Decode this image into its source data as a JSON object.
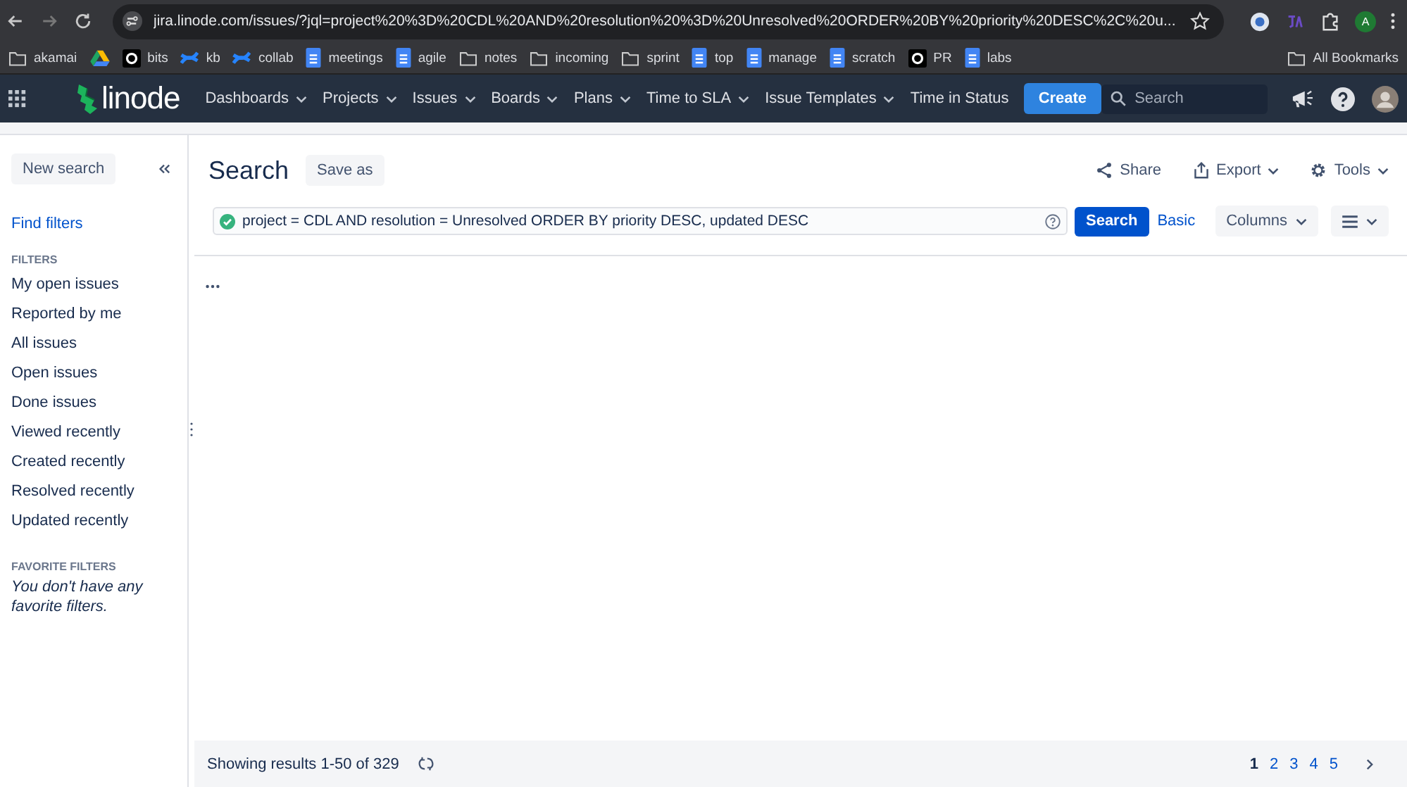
{
  "browser": {
    "url": "jira.linode.com/issues/?jql=project%20%3D%20CDL%20AND%20resolution%20%3D%20Unresolved%20ORDER%20BY%20priority%20DESC%2C%20u...",
    "profile": "A",
    "bookmarks": [
      {
        "label": "akamai",
        "kind": "folder"
      },
      {
        "kind": "drive"
      },
      {
        "label": "bits",
        "kind": "github"
      },
      {
        "label": "kb",
        "kind": "confluence"
      },
      {
        "label": "collab",
        "kind": "confluence"
      },
      {
        "label": "meetings",
        "kind": "doc"
      },
      {
        "label": "agile",
        "kind": "doc"
      },
      {
        "label": "notes",
        "kind": "folder"
      },
      {
        "label": "incoming",
        "kind": "folder"
      },
      {
        "label": "sprint",
        "kind": "folder"
      },
      {
        "label": "top",
        "kind": "doc"
      },
      {
        "label": "manage",
        "kind": "doc"
      },
      {
        "label": "scratch",
        "kind": "doc"
      },
      {
        "label": "PR",
        "kind": "github"
      },
      {
        "label": "labs",
        "kind": "doc"
      }
    ],
    "all_bookmarks": "All Bookmarks"
  },
  "nav": {
    "logo": "linode",
    "items": [
      {
        "label": "Dashboards",
        "dropdown": true
      },
      {
        "label": "Projects",
        "dropdown": true
      },
      {
        "label": "Issues",
        "dropdown": true
      },
      {
        "label": "Boards",
        "dropdown": true
      },
      {
        "label": "Plans",
        "dropdown": true
      },
      {
        "label": "Time to SLA",
        "dropdown": true
      },
      {
        "label": "Issue Templates",
        "dropdown": true
      },
      {
        "label": "Time in Status",
        "dropdown": false
      }
    ],
    "create": "Create",
    "search_placeholder": "Search"
  },
  "sidebar": {
    "new_search": "New search",
    "find_filters": "Find filters",
    "filters_heading": "FILTERS",
    "filters": [
      "My open issues",
      "Reported by me",
      "All issues",
      "Open issues",
      "Done issues",
      "Viewed recently",
      "Created recently",
      "Resolved recently",
      "Updated recently"
    ],
    "favorites_heading": "FAVORITE FILTERS",
    "favorites_empty": "You don't have any favorite filters."
  },
  "main": {
    "title": "Search",
    "save_as": "Save as",
    "actions": [
      {
        "label": "Share",
        "kind": "share",
        "dropdown": false
      },
      {
        "label": "Export",
        "kind": "export",
        "dropdown": true
      },
      {
        "label": "Tools",
        "kind": "tools",
        "dropdown": true
      }
    ],
    "query": "project = CDL AND resolution = Unresolved ORDER BY priority DESC, updated DESC",
    "query_valid": true,
    "search_button": "Search",
    "basic_link": "Basic",
    "columns_button": "Columns"
  },
  "footer": {
    "results": "Showing results 1-50 of 329",
    "pages": [
      {
        "label": "1",
        "selected": true
      },
      {
        "label": "2",
        "selected": false
      },
      {
        "label": "3",
        "selected": false
      },
      {
        "label": "4",
        "selected": false
      },
      {
        "label": "5",
        "selected": false
      }
    ]
  }
}
